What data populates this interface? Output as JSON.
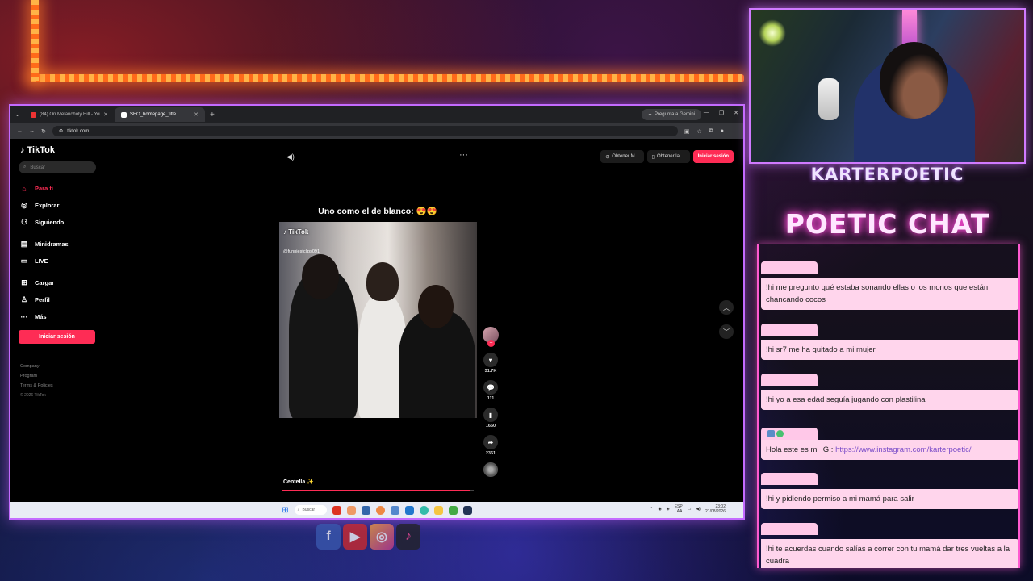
{
  "browser": {
    "tabs": [
      {
        "label": "(84) On Melancholy Hill - YouTube",
        "active": false
      },
      {
        "label": "SEO_homepage_title",
        "active": true
      }
    ],
    "gemini_label": "Pregunta a Gemini",
    "url": "tiktok.com"
  },
  "tiktok": {
    "logo": "TikTok",
    "search_placeholder": "Buscar",
    "nav": [
      {
        "label": "Para ti",
        "icon": "home-icon",
        "active": true
      },
      {
        "label": "Explorar",
        "icon": "compass-icon"
      },
      {
        "label": "Siguiendo",
        "icon": "users-icon"
      },
      {
        "label": "Minidramas",
        "icon": "film-icon"
      },
      {
        "label": "LIVE",
        "icon": "live-icon"
      },
      {
        "label": "Cargar",
        "icon": "upload-icon"
      },
      {
        "label": "Perfil",
        "icon": "profile-icon"
      },
      {
        "label": "Más",
        "icon": "more-icon"
      }
    ],
    "login_label": "Iniciar sesión",
    "footer": [
      "Company",
      "Program",
      "Terms & Policies"
    ],
    "copyright": "© 2026 TikTok",
    "top_buttons": [
      "Obtener M...",
      "Obtener la ..."
    ],
    "video": {
      "title": "Uno como el de blanco: 😍😍",
      "watermark": "TikTok",
      "watermark_user": "@funniestclips091",
      "caption": "Centella ✨",
      "progress": 0.98,
      "likes": "31.7K",
      "comments": "111",
      "saves": "1660",
      "shares": "2361"
    }
  },
  "taskbar": {
    "search_label": "Buscar",
    "lang": "ESP",
    "lang2": "LAA",
    "time": "23:02",
    "date": "21/08/2026"
  },
  "stream": {
    "channel": "KARTERPOETIC",
    "chat_title": "POETIC CHAT",
    "messages": [
      {
        "text": "!hi me pregunto qué estaba sonando ellas o los monos que están chancando cocos"
      },
      {
        "text": "!hi sr7 me ha quitado a mi mujer"
      },
      {
        "text": "!hi yo a esa edad seguía jugando con plastilina"
      },
      {
        "text": "Hola este es mi IG : ",
        "link": "https://www.instagram.com/karterpoetic/"
      },
      {
        "text": "!hi y pidiendo permiso a mi mamá para salir"
      },
      {
        "text": "!hi te acuerdas cuando salías a correr con tu mamá dar tres vueltas a la cuadra"
      }
    ]
  }
}
